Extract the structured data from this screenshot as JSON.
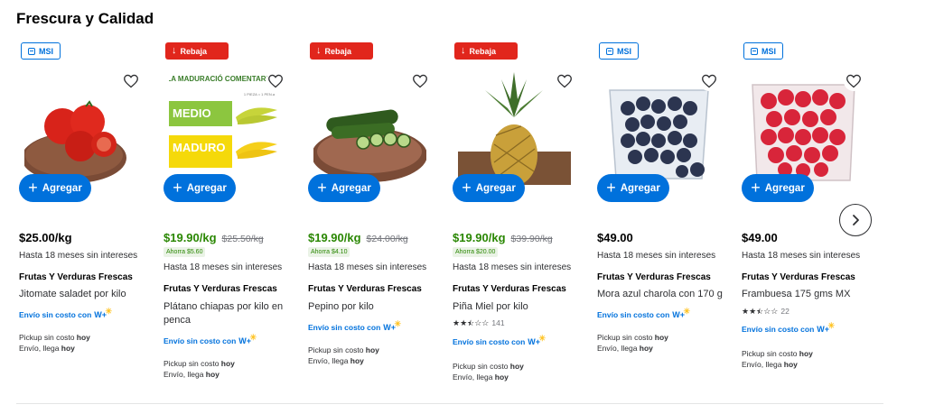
{
  "section": {
    "title": "Frescura y Calidad"
  },
  "common": {
    "add_label": "Agregar",
    "msi_text": "Hasta 18 meses sin intereses",
    "shipping_label": "Envío sin costo con",
    "wp_label": "W+",
    "pickup_label": "Pickup sin costo",
    "delivery_label": "Envío, llega",
    "today": "hoy"
  },
  "products": [
    {
      "badge": "MSI",
      "price": "$25.00/kg",
      "old_price": "",
      "savings": "",
      "brand": "Frutas Y Verduras Frescas",
      "name": "Jitomate saladet por kilo",
      "rating": "",
      "review_count": "",
      "image": "tomatoes"
    },
    {
      "badge": "Rebaja",
      "price": "$19.90/kg",
      "old_price": "$25.50/kg",
      "savings": "Ahorra $5.60",
      "brand": "Frutas Y Verduras Frescas",
      "name": "Plátano chiapas por kilo en penca",
      "rating": "",
      "review_count": "",
      "image": "bananas",
      "image_text": {
        "head": "AGREGA LA MADURACIÓ COMENTARIOS DE LA OR.",
        "sub": "1 PIEZA = 1 PEN.a",
        "medio": "MEDIO",
        "maduro": "MADURO"
      }
    },
    {
      "badge": "Rebaja",
      "price": "$19.90/kg",
      "old_price": "$24.00/kg",
      "savings": "Ahorra $4.10",
      "brand": "Frutas Y Verduras Frescas",
      "name": "Pepino por kilo",
      "rating": "",
      "review_count": "",
      "image": "cucumber"
    },
    {
      "badge": "Rebaja",
      "price": "$19.90/kg",
      "old_price": "$39.90/kg",
      "savings": "Ahorra $20.00",
      "brand": "Frutas Y Verduras Frescas",
      "name": "Piña Miel por kilo",
      "rating": 2.5,
      "review_count": "141",
      "image": "pineapple"
    },
    {
      "badge": "MSI",
      "price": "$49.00",
      "old_price": "",
      "savings": "",
      "brand": "Frutas Y Verduras Frescas",
      "name": "Mora azul charola con 170 g",
      "rating": "",
      "review_count": "",
      "image": "blueberries"
    },
    {
      "badge": "MSI",
      "price": "$49.00",
      "old_price": "",
      "savings": "",
      "brand": "Frutas Y Verduras Frescas",
      "name": "Frambuesa 175 gms MX",
      "rating": 2.5,
      "review_count": "22",
      "image": "raspberries"
    }
  ],
  "colors": {
    "accent": "#0071dc",
    "sale": "#2a8703",
    "rebaja": "#e1261c",
    "spark": "#ffc220"
  },
  "icons": {
    "favorite": "heart-icon",
    "next": "chevron-right-icon",
    "msi": "card-icon",
    "rebaja": "arrow-down-icon",
    "add": "plus-icon"
  }
}
